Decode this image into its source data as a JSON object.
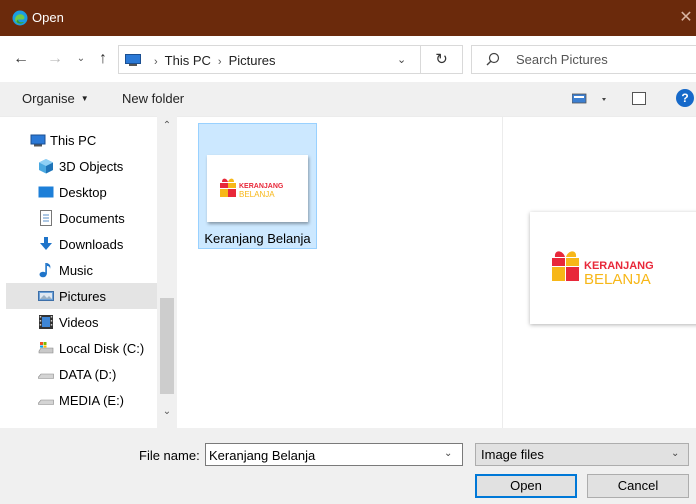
{
  "window": {
    "title": "Open",
    "close_glyph": "✕",
    "app_icon": "edge-icon",
    "titlebar_color": "#6b2a0c"
  },
  "nav": {
    "back_glyph": "←",
    "forward_glyph": "→",
    "recent_glyph": "⌄",
    "up_glyph": "↑",
    "refresh_glyph": "↻",
    "address_dropdown_glyph": "⌄"
  },
  "address": {
    "path": [
      "This PC",
      "Pictures"
    ],
    "separator": "›"
  },
  "search": {
    "placeholder": "Search Pictures"
  },
  "toolbar": {
    "organise_label": "Organise",
    "organise_caret": "▼",
    "new_folder_label": "New folder",
    "help_label": "?"
  },
  "sidebar": {
    "items": [
      {
        "label": "This PC",
        "icon": "pc-icon"
      },
      {
        "label": "3D Objects",
        "icon": "cube-icon"
      },
      {
        "label": "Desktop",
        "icon": "desktop-icon"
      },
      {
        "label": "Documents",
        "icon": "documents-icon"
      },
      {
        "label": "Downloads",
        "icon": "download-arrow-icon"
      },
      {
        "label": "Music",
        "icon": "music-note-icon"
      },
      {
        "label": "Pictures",
        "icon": "pictures-icon",
        "selected": true
      },
      {
        "label": "Videos",
        "icon": "film-icon"
      },
      {
        "label": "Local Disk (C:)",
        "icon": "drive-icon"
      },
      {
        "label": "DATA (D:)",
        "icon": "drive-icon"
      },
      {
        "label": "MEDIA (E:)",
        "icon": "drive-icon"
      }
    ],
    "scroll_up_glyph": "⌃",
    "scroll_down_glyph": "⌄"
  },
  "files": [
    {
      "name": "Keranjang Belanja",
      "selected": true
    }
  ],
  "logo": {
    "word1": "KERANJANG",
    "word2": "BELANJA",
    "red": "#e8283a",
    "yellow": "#f7b718"
  },
  "bottom": {
    "filename_label": "File name:",
    "filename_value": "Keranjang Belanja",
    "filename_dropdown_glyph": "⌄",
    "filetype_value": "Image files",
    "filetype_caret": "⌄",
    "open_label": "Open",
    "cancel_label": "Cancel"
  },
  "colors": {
    "accent": "#0078d7",
    "selection_fill": "#cce8ff",
    "selection_border": "#99d1ff"
  }
}
